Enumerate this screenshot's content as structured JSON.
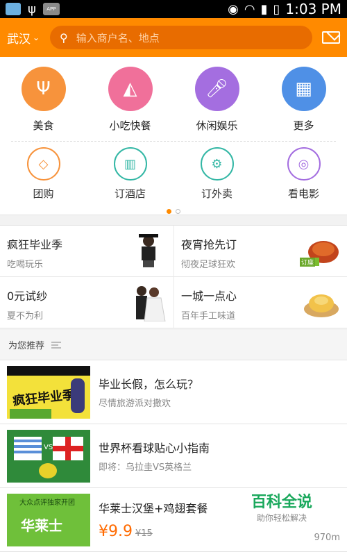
{
  "status_bar": {
    "time": "1:03 PM",
    "app_label": "APP"
  },
  "header": {
    "city": "武汉",
    "search_placeholder": "输入商户名、地点"
  },
  "categories_main": [
    {
      "label": "美食",
      "icon": "cutlery-icon",
      "color": "#f7933c"
    },
    {
      "label": "小吃快餐",
      "icon": "pizza-icon",
      "color": "#f0709a"
    },
    {
      "label": "休闲娱乐",
      "icon": "microphone-icon",
      "color": "#a46ee0"
    },
    {
      "label": "更多",
      "icon": "grid-icon",
      "color": "#4f90e6"
    }
  ],
  "categories_secondary": [
    {
      "label": "团购",
      "icon": "tag-icon",
      "color": "#f7933c"
    },
    {
      "label": "订酒店",
      "icon": "hotel-icon",
      "color": "#33b7a5"
    },
    {
      "label": "订外卖",
      "icon": "scooter-icon",
      "color": "#33b7a5"
    },
    {
      "label": "看电影",
      "icon": "film-icon",
      "color": "#a46ee0"
    }
  ],
  "promos": [
    {
      "title": "疯狂毕业季",
      "subtitle": "吃喝玩乐"
    },
    {
      "title": "夜宵抢先订",
      "subtitle": "彻夜足球狂欢",
      "badge": "订座"
    },
    {
      "title": "0元试纱",
      "subtitle": "夏不为利"
    },
    {
      "title": "一城一点心",
      "subtitle": "百年手工味道"
    }
  ],
  "recommend_title": "为您推荐",
  "list": [
    {
      "title": "毕业长假，怎么玩？",
      "subtitle": "尽情旅游派对撒欢",
      "thumb_text": "疯狂毕业季"
    },
    {
      "title": "世界杯看球贴心小指南",
      "subtitle": "即将：乌拉圭VS英格兰",
      "thumb_text": "VS"
    },
    {
      "title": "华莱士汉堡+鸡翅套餐",
      "price": "¥9.9",
      "old_price": "¥15",
      "distance": "970m",
      "thumb_text": "华莱士",
      "thumb_top": "大众点评独家开团"
    }
  ],
  "watermark": {
    "title": "百科全说",
    "subtitle": "助你轻松解决"
  }
}
